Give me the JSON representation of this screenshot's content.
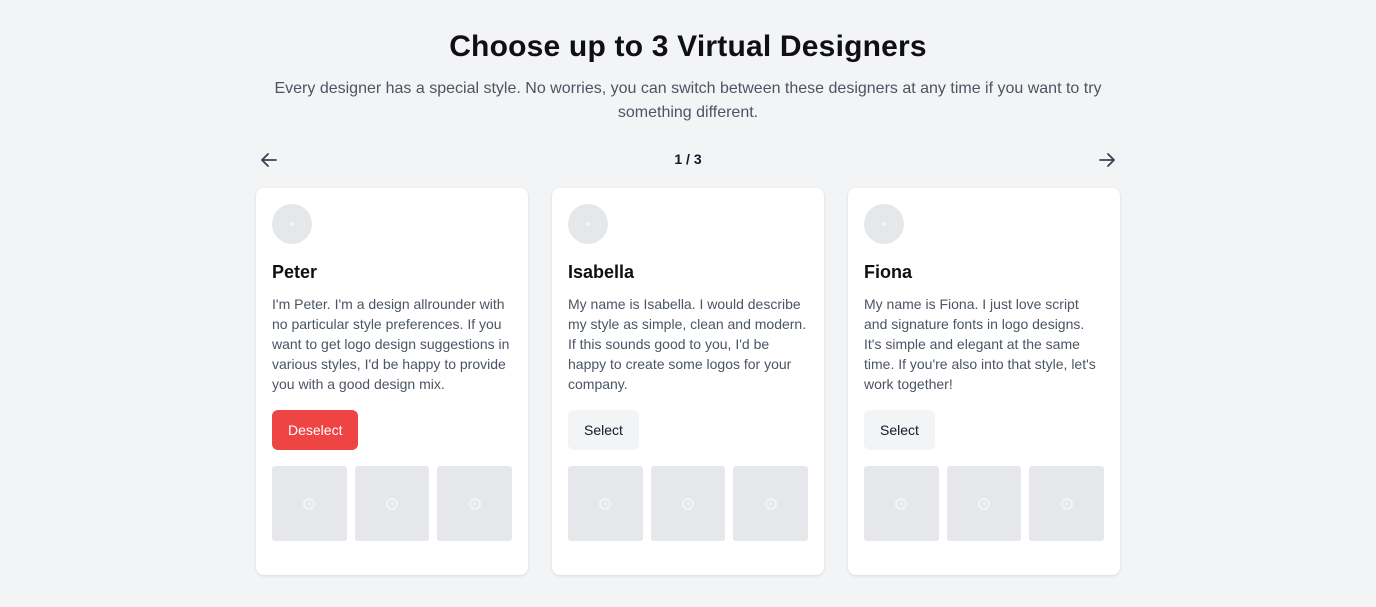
{
  "header": {
    "title": "Choose up to 3 Virtual Designers",
    "subtitle": "Every designer has a special style. No worries, you can switch between these designers at any time if you want to try something different."
  },
  "pagination": {
    "indicator": "1 / 3",
    "prev_icon": "arrow-left-icon",
    "next_icon": "arrow-right-icon"
  },
  "designers": [
    {
      "name": "Peter",
      "description": "I'm Peter. I'm a design allrounder with no particular style preferences. If you want to get logo design suggestions in various styles, I'd be happy to provide you with a good design mix.",
      "button_label": "Deselect",
      "selected": true
    },
    {
      "name": "Isabella",
      "description": "My name is Isabella. I would describe my style as simple, clean and modern. If this sounds good to you, I'd be happy to create some logos for your company.",
      "button_label": "Select",
      "selected": false
    },
    {
      "name": "Fiona",
      "description": "My name is Fiona. I just love script and signature fonts in logo designs. It's simple and elegant at the same time. If you're also into that style, let's work together!",
      "button_label": "Select",
      "selected": false
    }
  ],
  "colors": {
    "background": "#f3f4f6",
    "deselect_button": "#ef4444",
    "select_button": "#f3f4f6",
    "placeholder": "#e5e7eb"
  }
}
